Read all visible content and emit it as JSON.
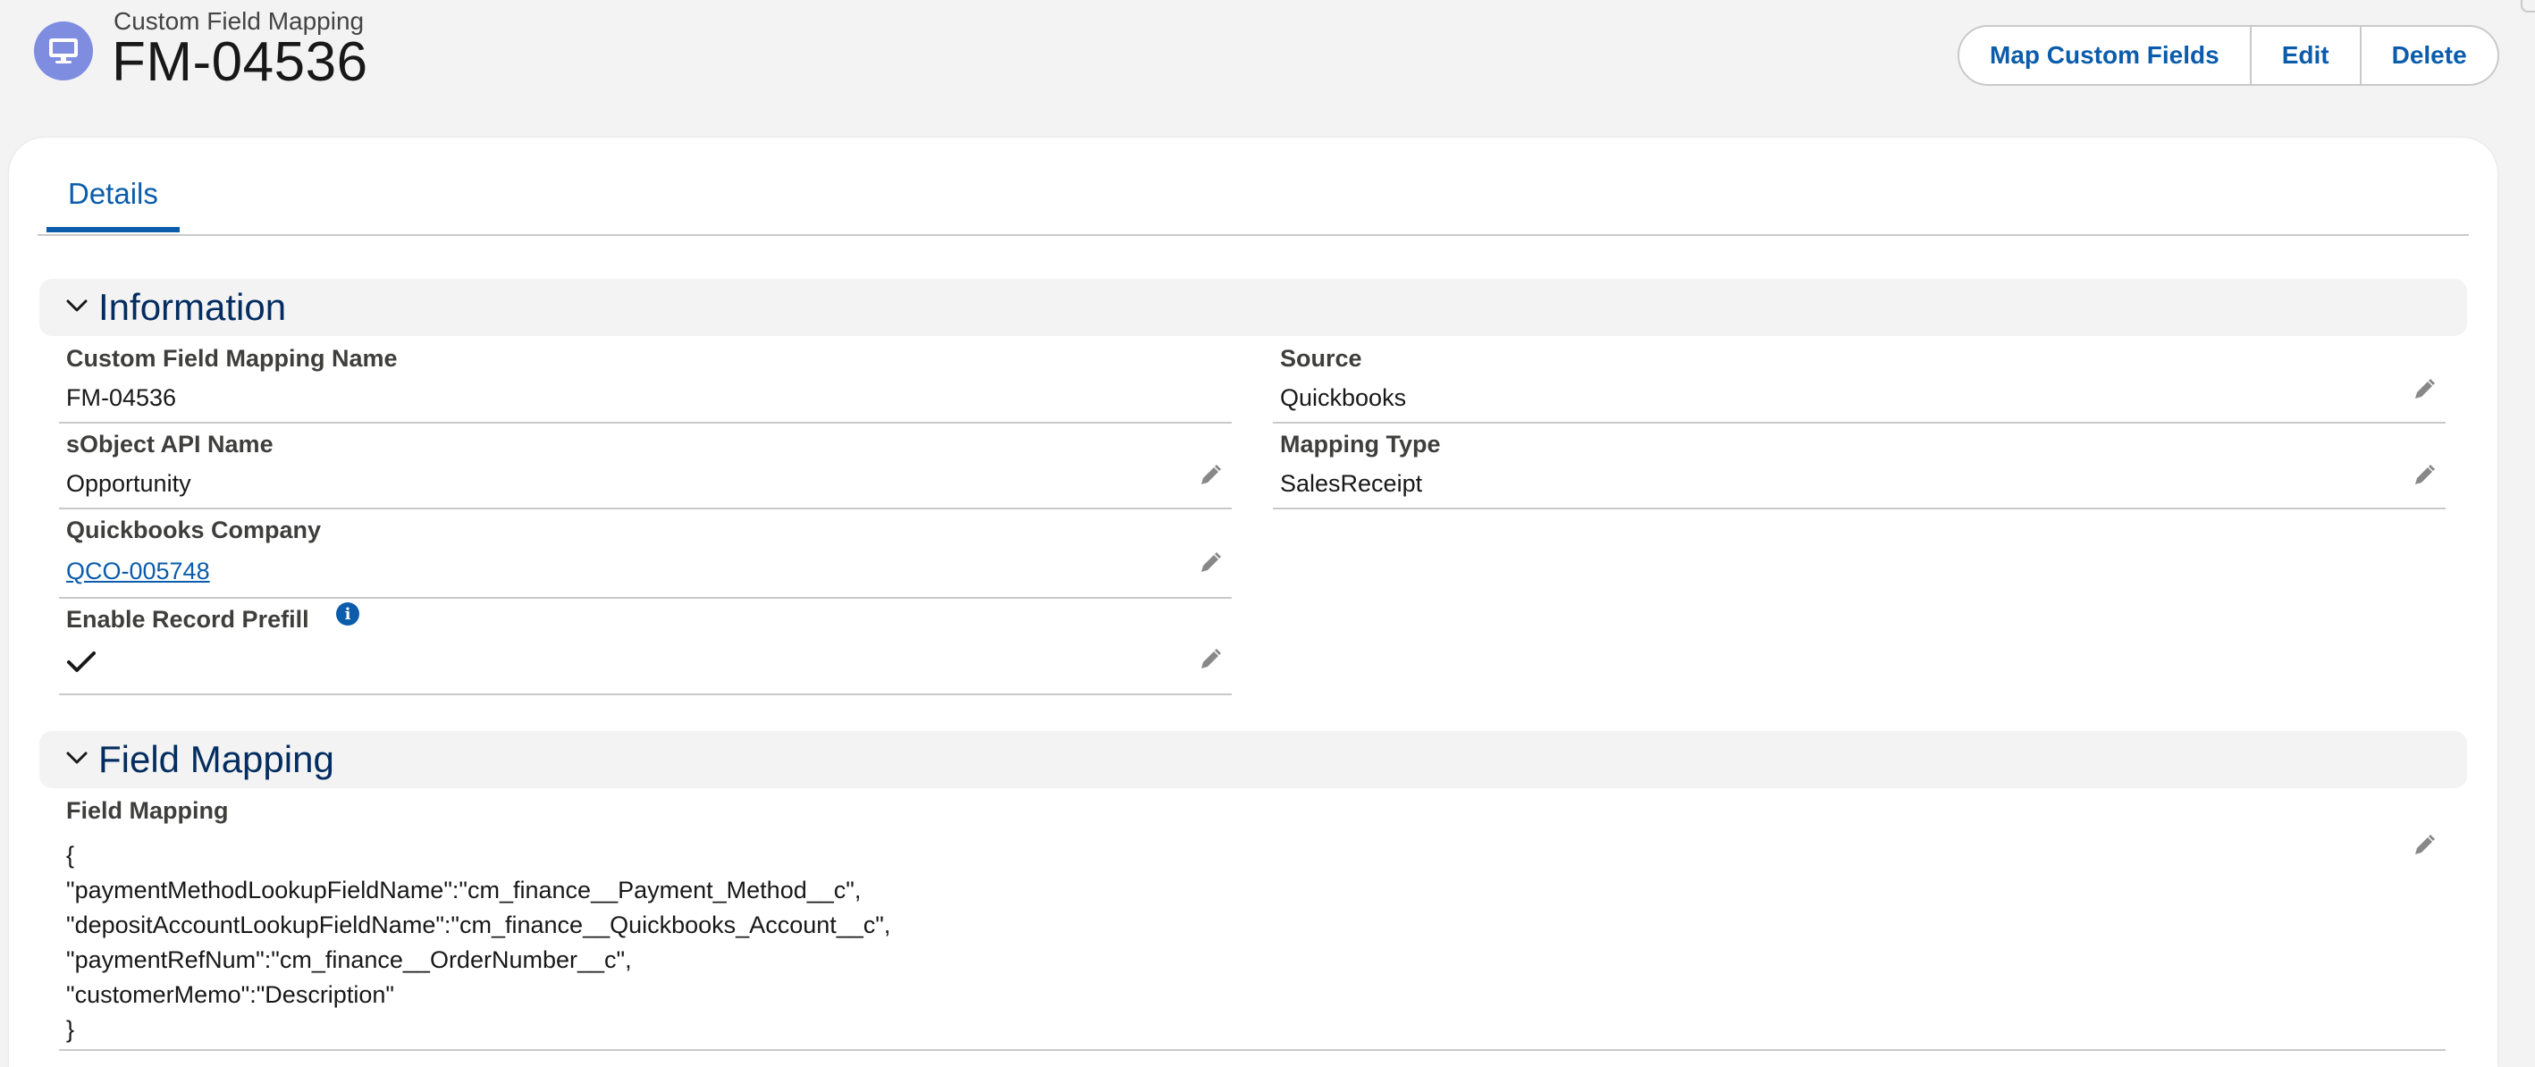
{
  "header": {
    "object_type": "Custom Field Mapping",
    "title": "FM-04536",
    "object_icon": "desktop-monitor-icon",
    "actions": [
      "Map Custom Fields",
      "Edit",
      "Delete"
    ]
  },
  "tabs": [
    {
      "label": "Details",
      "active": true
    }
  ],
  "sections": {
    "information": {
      "title": "Information",
      "fields": {
        "name": {
          "label": "Custom Field Mapping Name",
          "value": "FM-04536"
        },
        "sobject": {
          "label": "sObject API Name",
          "value": "Opportunity"
        },
        "company": {
          "label": "Quickbooks Company",
          "value": "QCO-005748"
        },
        "prefill": {
          "label": "Enable Record Prefill",
          "value": "checked"
        },
        "source": {
          "label": "Source",
          "value": "Quickbooks"
        },
        "mapping_type": {
          "label": "Mapping Type",
          "value": "SalesReceipt"
        }
      }
    },
    "field_mapping": {
      "title": "Field Mapping",
      "label": "Field Mapping",
      "lines": [
        "{",
        "\"paymentMethodLookupFieldName\":\"cm_finance__Payment_Method__c\",",
        "\"depositAccountLookupFieldName\":\"cm_finance__Quickbooks_Account__c\",",
        "\"paymentRefNum\":\"cm_finance__OrderNumber__c\",",
        "\"customerMemo\":\"Description\"",
        "}"
      ]
    }
  },
  "colors": {
    "brand": "#0b5cab",
    "icon_bg": "#7f8de1",
    "heading": "#032d60"
  }
}
